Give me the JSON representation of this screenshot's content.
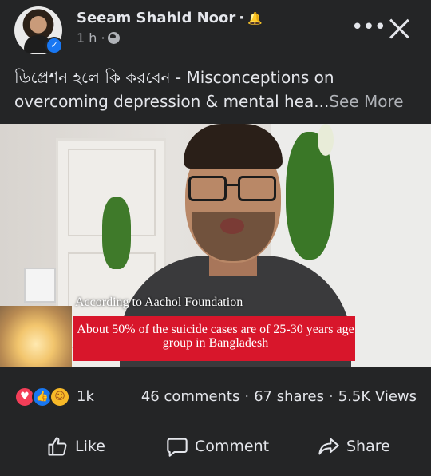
{
  "post": {
    "author": "Seeam Shahid Noor",
    "bell_glyph": "🔔",
    "separator": "·",
    "time": "1 h",
    "meta_separator": "·",
    "privacy_icon": "globe-icon",
    "more_glyph": "•••",
    "caption": "ডিপ্রেশন হলে কি করবেন - Misconceptions on overcoming depression & mental hea...",
    "see_more": "See More"
  },
  "video": {
    "subtitle_top": "According to Aachol Foundation",
    "subtitle_banner": "About 50% of the suicide cases are of 25-30 years age group in Bangladesh",
    "banner_color": "#d8162b"
  },
  "stats": {
    "reactions": [
      "love-reaction-icon",
      "like-reaction-icon",
      "care-reaction-icon"
    ],
    "reaction_count": "1k",
    "comments": "46 comments",
    "shares": "67 shares",
    "views": "5.5K Views",
    "dot": "·"
  },
  "actions": {
    "like": "Like",
    "comment": "Comment",
    "share": "Share"
  },
  "colors": {
    "background": "#242526",
    "text": "#e4e6eb",
    "secondary_text": "#b0b3b8",
    "verified": "#1877f2"
  }
}
